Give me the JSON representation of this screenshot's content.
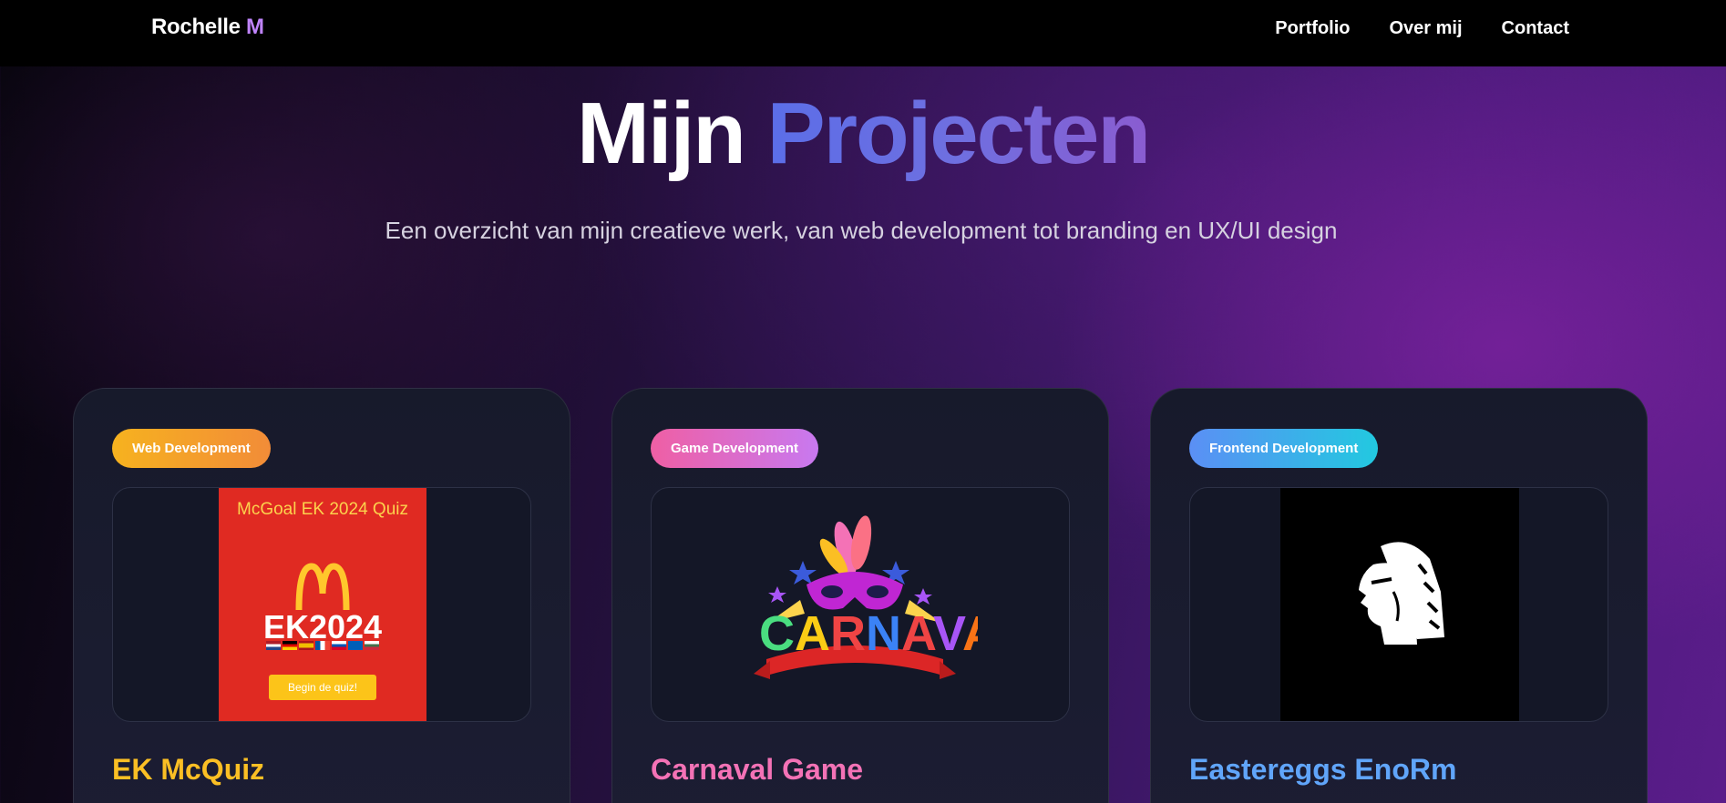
{
  "header": {
    "logo_main": "Rochelle",
    "logo_accent": "M",
    "nav": [
      "Portfolio",
      "Over mij",
      "Contact"
    ]
  },
  "hero": {
    "title_word1": "Mijn",
    "title_word2": "Projecten",
    "subtitle": "Een overzicht van mijn creatieve werk, van web development tot branding en UX/UI design"
  },
  "projects": [
    {
      "category": "Web Development",
      "title": "EK McQuiz",
      "thumb": {
        "title": "McGoal EK 2024 Quiz",
        "logo": "M",
        "headline": "EK2024",
        "button": "Begin de quiz!"
      }
    },
    {
      "category": "Game Development",
      "title": "Carnaval Game",
      "thumb": {
        "logo": "CARNAVAL"
      }
    },
    {
      "category": "Frontend Development",
      "title": "Eastereggs EnoRm",
      "thumb": {
        "icon": "warrior-head-logo"
      }
    }
  ],
  "colors": {
    "accent_purple": "#c084fc",
    "badge_web": "#f6b21f",
    "badge_game": "#ef5fa4",
    "badge_frontend": "#5b8ff5",
    "title_yellow": "#fbbf24",
    "title_pink": "#f472b6",
    "title_blue": "#60a5fa"
  }
}
